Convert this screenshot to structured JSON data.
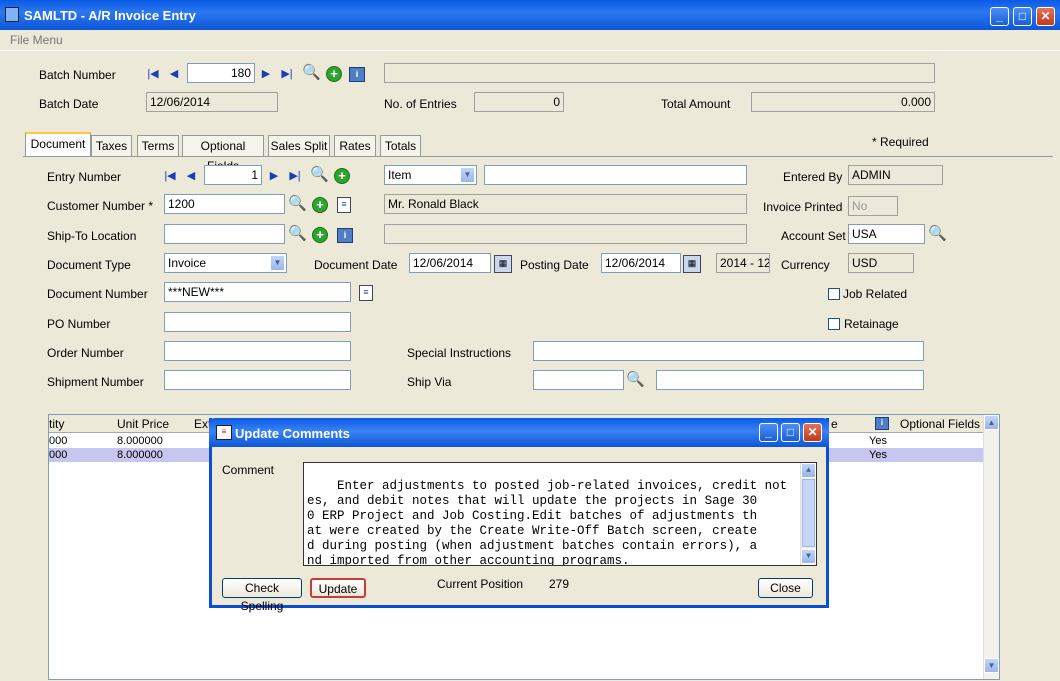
{
  "window": {
    "title": "SAMLTD - A/R Invoice Entry",
    "minimize": "_",
    "maximize": "□",
    "close": "✕"
  },
  "menu": {
    "file": "File Menu"
  },
  "icons": {
    "first": "|◀",
    "prev": "◀",
    "next": "▶",
    "last": "▶|",
    "search": "🔍",
    "new": "+",
    "info": "i",
    "doc": "≡",
    "calendar": "▦",
    "dropdown": "▼",
    "up": "▲",
    "down": "▼"
  },
  "header": {
    "batch_number_label": "Batch Number",
    "batch_number": "180",
    "batch_desc": "",
    "batch_date_label": "Batch Date",
    "batch_date": "12/06/2014",
    "entries_label": "No. of Entries",
    "entries": "0",
    "total_label": "Total Amount",
    "total": "0.000"
  },
  "required_note": "*  Required",
  "tabs": [
    "Document",
    "Taxes",
    "Terms",
    "Optional Fields",
    "Sales Split",
    "Rates",
    "Totals"
  ],
  "form": {
    "entry_number_label": "Entry Number",
    "entry_number": "1",
    "entry_type": "Item",
    "entry_desc": "",
    "entered_by_label": "Entered By",
    "entered_by": "ADMIN",
    "customer_label": "Customer Number *",
    "customer": "1200",
    "customer_name": "Mr. Ronald Black",
    "printed_label": "Invoice Printed",
    "printed": "No",
    "shipto_label": "Ship-To Location",
    "shipto": "",
    "shipto_desc": "",
    "account_set_label": "Account Set",
    "account_set": "USA",
    "doctype_label": "Document Type",
    "doctype": "Invoice",
    "docdate_label": "Document Date",
    "docdate": "12/06/2014",
    "postdate_label": "Posting Date",
    "postdate": "12/06/2014",
    "period": "2014 - 12",
    "currency_label": "Currency",
    "currency": "USD",
    "docnum_label": "Document Number",
    "docnum": "***NEW***",
    "job_related_label": "Job Related",
    "job_related": false,
    "po_label": "PO Number",
    "po": "",
    "retainage_label": "Retainage",
    "retainage": false,
    "order_label": "Order Number",
    "order": "",
    "special_label": "Special Instructions",
    "special": "",
    "shipment_label": "Shipment Number",
    "shipment": "",
    "shipvia_label": "Ship Via",
    "shipvia": "",
    "shipvia_desc": ""
  },
  "grid": {
    "headers": {
      "qty": "tity",
      "unit_price": "Unit Price",
      "ext": "Ext",
      "e": "e",
      "optional": "Optional Fields"
    },
    "rows": [
      {
        "qty": "000",
        "unit_price": "8.000000",
        "optional": "Yes"
      },
      {
        "qty": "000",
        "unit_price": "8.000000",
        "optional": "Yes"
      }
    ]
  },
  "dialog": {
    "title": "Update Comments",
    "comment_label": "Comment",
    "comment": "Enter adjustments to posted job-related invoices, credit not\nes, and debit notes that will update the projects in Sage 30\n0 ERP Project and Job Costing.Edit batches of adjustments th\nat were created by the Create Write-Off Batch screen, create\nd during posting (when adjustment batches contain errors), a\nnd imported from other accounting programs.",
    "check_spelling": "Check Spelling",
    "update": "Update",
    "position_label": "Current Position",
    "position": "279",
    "close": "Close"
  }
}
